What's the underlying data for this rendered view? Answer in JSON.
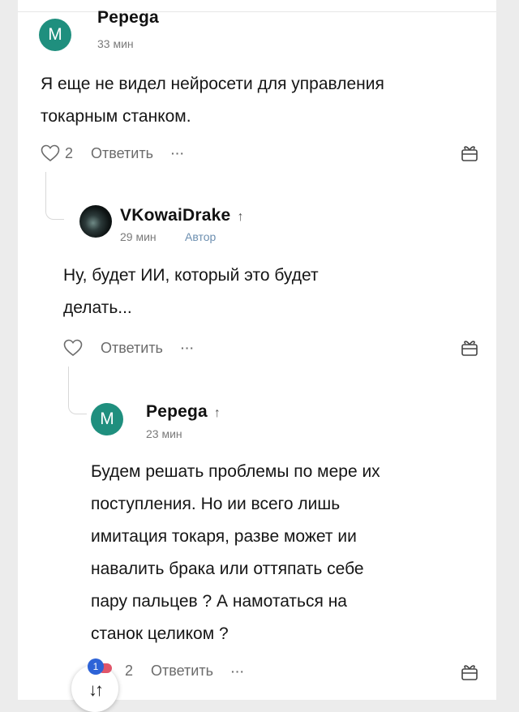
{
  "comments": [
    {
      "avatar_letter": "M",
      "author": "Pepega",
      "time": "33 мин",
      "text_lines": [
        "Я еще не видел нейросети для управления",
        "токарным станком."
      ],
      "likes": "2",
      "reply_label": "Ответить",
      "more": "···"
    },
    {
      "author": "VKowaiDrake",
      "reply_arrow": "↑",
      "time": "29 мин",
      "badge": "Автор",
      "text_lines": [
        "Ну, будет ИИ, который это будет",
        "делать..."
      ],
      "reply_label": "Ответить",
      "more": "···"
    },
    {
      "avatar_letter": "M",
      "author": "Pepega",
      "reply_arrow": "↑",
      "time": "23 мин",
      "text_lines": [
        "Будем решать проблемы по мере их",
        "поступления. Но ии всего лишь",
        "имитация токаря, разве может ии",
        "навалить брака или оттяпать себе",
        "пару пальцев ? А намотаться на",
        "станок целиком ?"
      ],
      "likes": "2",
      "reply_label": "Ответить",
      "more": "···"
    }
  ],
  "fab": {
    "icon": "sort-arrows-icon",
    "glyph": "↓↑",
    "badge": "1"
  },
  "colors": {
    "avatar": "#1f8f7e",
    "author_badge": "#6d8fb0",
    "fab_badge": "#2d63d7"
  }
}
